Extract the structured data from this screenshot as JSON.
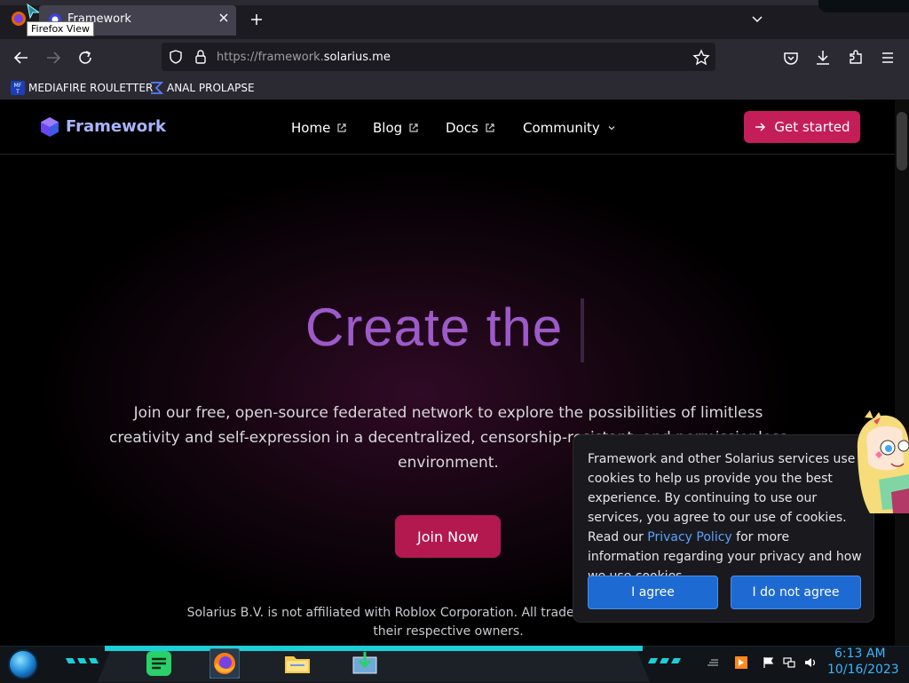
{
  "browser": {
    "tab_title": "Framework",
    "tooltip": "Firefox View",
    "url_prefix": "https://framework.",
    "url_host": "solarius.me",
    "bookmarks": [
      {
        "label": "MEDIAFIRE ROULETTER",
        "icon": "mediafire-icon"
      },
      {
        "label": "ANAL PROLAPSE",
        "icon": "bookmark-sigma-icon"
      }
    ]
  },
  "site": {
    "logo_text": "Framework",
    "nav": [
      {
        "label": "Home"
      },
      {
        "label": "Blog"
      },
      {
        "label": "Docs"
      },
      {
        "label": "Community"
      }
    ],
    "cta": "Get started",
    "hero_title": "Create the",
    "hero_description": "Join our free, open-source federated network to explore the possibilities of limitless creativity and self-expression in a decentralized, censorship-resistant, and permissionless environment.",
    "join_button": "Join Now",
    "disclaimer": "Solarius B.V. is not affiliated with Roblox Corporation. All trademarks are property of their respective owners."
  },
  "cookie": {
    "text_before": "Framework and other Solarius services use cookies to help us provide you the best experience. By continuing to use our services, you agree to our use of cookies. Read our ",
    "link": "Privacy Policy",
    "text_after": " for more information regarding your privacy and how we use cookies.",
    "agree": "I agree",
    "disagree": "I do not agree"
  },
  "taskbar": {
    "time": "6:13 AM",
    "date": "10/16/2023"
  },
  "colors": {
    "accent": "#c41e58",
    "hero_gradient": "#9d5ac9",
    "cookie_button": "#1e6ad3",
    "clock": "#3ab6ff"
  }
}
